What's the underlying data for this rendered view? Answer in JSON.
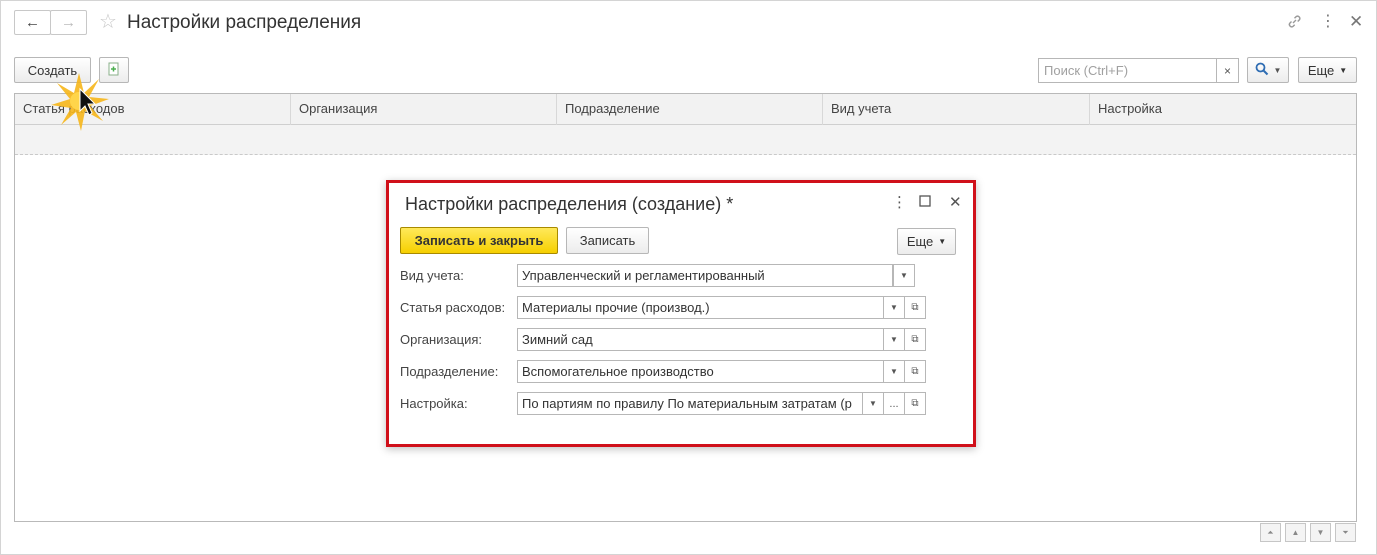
{
  "window": {
    "title": "Настройки распределения",
    "back_icon": "←",
    "forward_icon": "→"
  },
  "toolbar": {
    "create_label": "Создать",
    "search_placeholder": "Поиск (Ctrl+F)",
    "search_clear": "×",
    "more_label": "Еще"
  },
  "table": {
    "columns": [
      "Статья расходов",
      "Организация",
      "Подразделение",
      "Вид учета",
      "Настройка"
    ]
  },
  "dialog": {
    "title": "Настройки распределения (создание) *",
    "save_close_label": "Записать и закрыть",
    "save_label": "Записать",
    "more_label": "Еще",
    "fields": [
      {
        "label": "Вид учета:",
        "value": "Управленческий и регламентированный"
      },
      {
        "label": "Статья расходов:",
        "value": "Материалы прочие (производ.)"
      },
      {
        "label": "Организация:",
        "value": "Зимний сад"
      },
      {
        "label": "Подразделение:",
        "value": "Вспомогательное производство"
      },
      {
        "label": "Настройка:",
        "value": "По партиям по правилу По материальным затратам (р"
      }
    ],
    "ellipsis": "..."
  },
  "colors": {
    "dialog_border": "#d0101a",
    "primary_button": "#f6cf00"
  }
}
